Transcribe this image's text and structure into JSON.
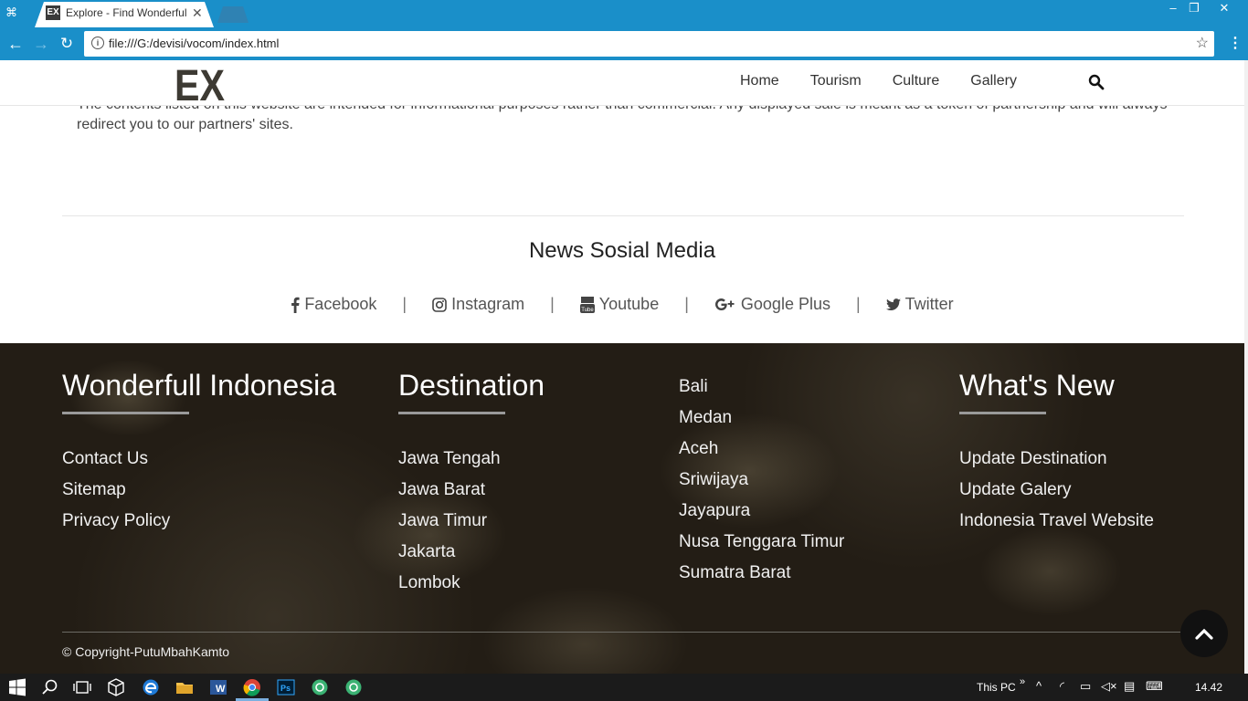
{
  "browser": {
    "tab_title": "Explore - Find Wonderful",
    "tab_favicon_text": "EX",
    "url": "file:///G:/devisi/vocom/index.html"
  },
  "site_nav": {
    "logo_text": "EX",
    "items": [
      "Home",
      "Tourism",
      "Culture",
      "Gallery"
    ]
  },
  "intro": {
    "text": "The contents listed on this website are intended for informational purposes rather than commercial. Any displayed sale is meant as a token of partnership and will always redirect you to our partners' sites."
  },
  "social": {
    "title": "News Sosial Media",
    "items": [
      {
        "label": "Facebook",
        "icon": "facebook-icon"
      },
      {
        "label": "Instagram",
        "icon": "instagram-icon"
      },
      {
        "label": "Youtube",
        "icon": "youtube-icon"
      },
      {
        "label": "Google Plus",
        "icon": "google-plus-icon"
      },
      {
        "label": "Twitter",
        "icon": "twitter-icon"
      }
    ],
    "separator": "|"
  },
  "footer": {
    "col1": {
      "heading": "Wonderfull Indonesia",
      "links": [
        "Contact Us",
        "Sitemap",
        "Privacy Policy"
      ]
    },
    "col2": {
      "heading": "Destination",
      "links": [
        "Jawa Tengah",
        "Jawa Barat",
        "Jawa Timur",
        "Jakarta",
        "Lombok"
      ]
    },
    "col3": {
      "links": [
        "Bali",
        "Medan",
        "Aceh",
        "Sriwijaya",
        "Jayapura",
        "Nusa Tenggara Timur",
        "Sumatra Barat"
      ]
    },
    "col4": {
      "heading": "What's New",
      "links": [
        "Update Destination",
        "Update Galery",
        "Indonesia Travel Website"
      ]
    },
    "copyright": "© Copyright-PutuMbahKamto"
  },
  "taskbar": {
    "this_pc": "This PC",
    "clock": "14.42"
  },
  "colors": {
    "chrome_blue": "#1a8fc9",
    "footer_bg": "#231d15",
    "taskbar": "#1b1b1b"
  }
}
